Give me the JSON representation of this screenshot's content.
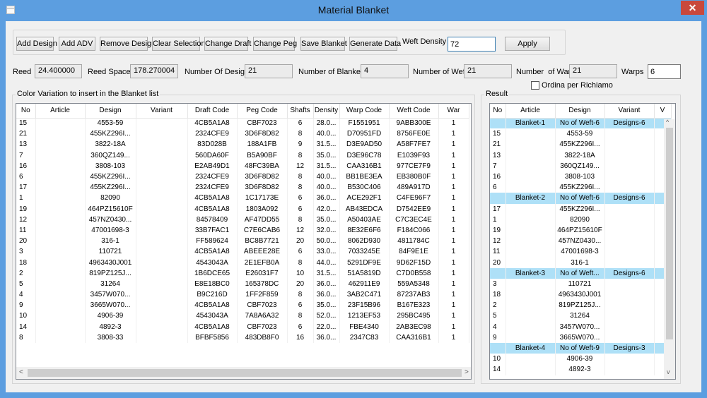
{
  "window": {
    "title": "Material Blanket",
    "close_glyph": "✕"
  },
  "toolbar": {
    "buttons": [
      "Add Design",
      "Add ADV",
      "Remove Design",
      "Clear Selection",
      "Change Draft",
      "Change Peg",
      "Save Blanket",
      "Generate Data"
    ],
    "weft_density_label": "Weft Density",
    "weft_density_value": "72",
    "apply_label": "Apply"
  },
  "info": {
    "reed_label": "Reed",
    "reed_value": "24.400000",
    "reed_space_label": "Reed Space",
    "reed_space_value": "178.270004",
    "num_designs_label": "Number Of Designs",
    "num_designs_value": "21",
    "num_blankets_label": "Number of Blankets",
    "num_blankets_value": "4",
    "num_weft_label": "Number of Weft",
    "num_weft_value": "21",
    "num_warp_label": "Number  of Warp",
    "num_warp_value": "21",
    "warps_label": "Warps",
    "warps_value": "6",
    "ordina_label": "Ordina per Richiamo",
    "ordina_checked": false
  },
  "color_variation": {
    "title": "Color Variation to insert in the Blanket list",
    "columns": [
      "No",
      "Article",
      "Design",
      "Variant",
      "Draft Code",
      "Peg Code",
      "Shafts",
      "Density",
      "Warp Code",
      "Weft Code",
      "War"
    ],
    "rows": [
      [
        "15",
        "",
        "4553-59",
        "",
        "4CB5A1A8",
        "CBF7023",
        "6",
        "28.0...",
        "F1551951",
        "9ABB300E",
        "1"
      ],
      [
        "21",
        "",
        "455KZ296I...",
        "",
        "2324CFE9",
        "3D6F8D82",
        "8",
        "40.0...",
        "D70951FD",
        "8756FE0E",
        "1"
      ],
      [
        "13",
        "",
        "3822-18A",
        "",
        "83D028B",
        "188A1FB",
        "9",
        "31.5...",
        "D3E9AD50",
        "A58F7FE7",
        "1"
      ],
      [
        "7",
        "",
        "360QZ149...",
        "",
        "560DA60F",
        "B5A90BF",
        "8",
        "35.0...",
        "D3E96C78",
        "E1039F93",
        "1"
      ],
      [
        "16",
        "",
        "3808-103",
        "",
        "E2AB49D1",
        "48FC39BA",
        "12",
        "31.5...",
        "CAA316B1",
        "977CE7F9",
        "1"
      ],
      [
        "6",
        "",
        "455KZ296I...",
        "",
        "2324CFE9",
        "3D6F8D82",
        "8",
        "40.0...",
        "BB1BE3EA",
        "EB380B0F",
        "1"
      ],
      [
        "17",
        "",
        "455KZ296I...",
        "",
        "2324CFE9",
        "3D6F8D82",
        "8",
        "40.0...",
        "B530C406",
        "489A917D",
        "1"
      ],
      [
        "1",
        "",
        "82090",
        "",
        "4CB5A1A8",
        "1C17173E",
        "6",
        "36.0...",
        "ACE292F1",
        "C4FE96F7",
        "1"
      ],
      [
        "19",
        "",
        "464PZ15610F",
        "",
        "4CB5A1A8",
        "1803A092",
        "6",
        "42.0...",
        "AB43EDCA",
        "D7542EE9",
        "1"
      ],
      [
        "12",
        "",
        "457NZ0430...",
        "",
        "84578409",
        "AF47DD55",
        "8",
        "35.0...",
        "A50403AE",
        "C7C3EC4E",
        "1"
      ],
      [
        "11",
        "",
        "47001698-3",
        "",
        "33B7FAC1",
        "C7E6CAB6",
        "12",
        "32.0...",
        "8E32E6F6",
        "F184C066",
        "1"
      ],
      [
        "20",
        "",
        "316-1",
        "",
        "FF589624",
        "BC8B7721",
        "20",
        "50.0...",
        "8062D930",
        "4811784C",
        "1"
      ],
      [
        "3",
        "",
        "110721",
        "",
        "4CB5A1A8",
        "ABEEE28E",
        "6",
        "33.0...",
        "7033245E",
        "84F9E1E",
        "1"
      ],
      [
        "18",
        "",
        "4963430J001",
        "",
        "4543043A",
        "2E1EFB0A",
        "8",
        "44.0...",
        "5291DF9E",
        "9D62F15D",
        "1"
      ],
      [
        "2",
        "",
        "819PZ125J...",
        "",
        "1B6DCE65",
        "E26031F7",
        "10",
        "31.5...",
        "51A5819D",
        "C7D0B558",
        "1"
      ],
      [
        "5",
        "",
        "31264",
        "",
        "E8E18BC0",
        "165378DC",
        "20",
        "36.0...",
        "462911E9",
        "559A5348",
        "1"
      ],
      [
        "4",
        "",
        "3457W070...",
        "",
        "B9C216D",
        "1FF2F859",
        "8",
        "36.0...",
        "3AB2C471",
        "87237AB3",
        "1"
      ],
      [
        "9",
        "",
        "3665W070...",
        "",
        "4CB5A1A8",
        "CBF7023",
        "6",
        "35.0...",
        "23F15B96",
        "B167E323",
        "1"
      ],
      [
        "10",
        "",
        "4906-39",
        "",
        "4543043A",
        "7A8A6A32",
        "8",
        "52.0...",
        "1213EF53",
        "295BC495",
        "1"
      ],
      [
        "14",
        "",
        "4892-3",
        "",
        "4CB5A1A8",
        "CBF7023",
        "6",
        "22.0...",
        "FBE4340",
        "2AB3EC98",
        "1"
      ],
      [
        "8",
        "",
        "3808-33",
        "",
        "BFBF5856",
        "483DB8F0",
        "16",
        "36.0...",
        "2347C83",
        "CAA316B1",
        "1"
      ]
    ]
  },
  "result": {
    "title": "Result",
    "columns": [
      "No",
      "Article",
      "Design",
      "Variant",
      "V"
    ],
    "rows": [
      {
        "type": "blanket",
        "cells": [
          "",
          "Blanket-1",
          "No of Weft-6",
          "Designs-6",
          ""
        ]
      },
      {
        "type": "item",
        "cells": [
          "15",
          "",
          "4553-59",
          "",
          ""
        ]
      },
      {
        "type": "item",
        "cells": [
          "21",
          "",
          "455KZ296I...",
          "",
          ""
        ]
      },
      {
        "type": "item",
        "cells": [
          "13",
          "",
          "3822-18A",
          "",
          ""
        ]
      },
      {
        "type": "item",
        "cells": [
          "7",
          "",
          "360QZ149...",
          "",
          ""
        ]
      },
      {
        "type": "item",
        "cells": [
          "16",
          "",
          "3808-103",
          "",
          ""
        ]
      },
      {
        "type": "item",
        "cells": [
          "6",
          "",
          "455KZ296I...",
          "",
          ""
        ]
      },
      {
        "type": "blanket",
        "cells": [
          "",
          "Blanket-2",
          "No of Weft-6",
          "Designs-6",
          ""
        ]
      },
      {
        "type": "item",
        "cells": [
          "17",
          "",
          "455KZ296I...",
          "",
          ""
        ]
      },
      {
        "type": "item",
        "cells": [
          "1",
          "",
          "82090",
          "",
          ""
        ]
      },
      {
        "type": "item",
        "cells": [
          "19",
          "",
          "464PZ15610F",
          "",
          ""
        ]
      },
      {
        "type": "item",
        "cells": [
          "12",
          "",
          "457NZ0430...",
          "",
          ""
        ]
      },
      {
        "type": "item",
        "cells": [
          "11",
          "",
          "47001698-3",
          "",
          ""
        ]
      },
      {
        "type": "item",
        "cells": [
          "20",
          "",
          "316-1",
          "",
          ""
        ]
      },
      {
        "type": "blanket",
        "cells": [
          "",
          "Blanket-3",
          "No of Weft...",
          "Designs-6",
          ""
        ]
      },
      {
        "type": "item",
        "cells": [
          "3",
          "",
          "110721",
          "",
          ""
        ]
      },
      {
        "type": "item",
        "cells": [
          "18",
          "",
          "4963430J001",
          "",
          ""
        ]
      },
      {
        "type": "item",
        "cells": [
          "2",
          "",
          "819PZ125J...",
          "",
          ""
        ]
      },
      {
        "type": "item",
        "cells": [
          "5",
          "",
          "31264",
          "",
          ""
        ]
      },
      {
        "type": "item",
        "cells": [
          "4",
          "",
          "3457W070...",
          "",
          ""
        ]
      },
      {
        "type": "item",
        "cells": [
          "9",
          "",
          "3665W070...",
          "",
          ""
        ]
      },
      {
        "type": "blanket",
        "cells": [
          "",
          "Blanket-4",
          "No of Weft-9",
          "Designs-3",
          ""
        ]
      },
      {
        "type": "item",
        "cells": [
          "10",
          "",
          "4906-39",
          "",
          ""
        ]
      },
      {
        "type": "item",
        "cells": [
          "14",
          "",
          "4892-3",
          "",
          ""
        ]
      }
    ]
  },
  "scroll_glyphs": {
    "left": "<",
    "right": ">",
    "up": "^",
    "down": "v"
  }
}
